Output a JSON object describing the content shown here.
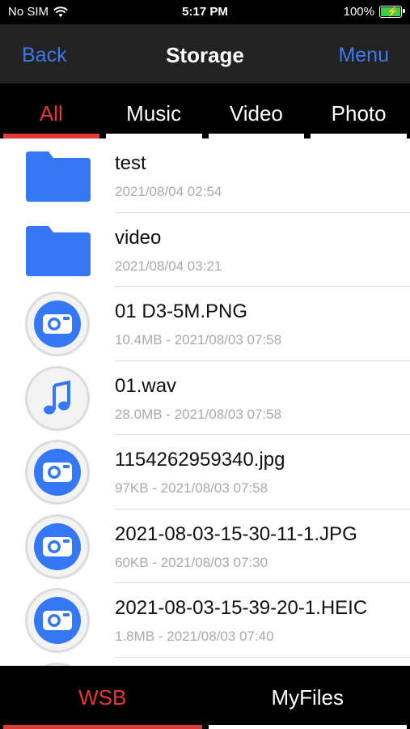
{
  "status_bar": {
    "carrier": "No SIM",
    "time": "5:17 PM",
    "battery": "100%"
  },
  "nav": {
    "back": "Back",
    "title": "Storage",
    "menu": "Menu"
  },
  "tabs": [
    {
      "label": "All",
      "active": true
    },
    {
      "label": "Music",
      "active": false
    },
    {
      "label": "Video",
      "active": false
    },
    {
      "label": "Photo",
      "active": false
    }
  ],
  "files": [
    {
      "type": "folder",
      "name": "test",
      "meta": "2021/08/04 02:54"
    },
    {
      "type": "folder",
      "name": "video",
      "meta": "2021/08/04 03:21"
    },
    {
      "type": "photo",
      "name": "01 D3-5M.PNG",
      "meta": "10.4MB - 2021/08/03 07:58"
    },
    {
      "type": "music",
      "name": "01.wav",
      "meta": "28.0MB - 2021/08/03 07:58"
    },
    {
      "type": "photo",
      "name": "1154262959340.jpg",
      "meta": "97KB - 2021/08/03 07:58"
    },
    {
      "type": "photo",
      "name": "2021-08-03-15-30-11-1.JPG",
      "meta": "60KB - 2021/08/03 07:30"
    },
    {
      "type": "photo",
      "name": "2021-08-03-15-39-20-1.HEIC",
      "meta": "1.8MB - 2021/08/03 07:40"
    }
  ],
  "bottom_tabs": [
    {
      "label": "WSB",
      "active": true
    },
    {
      "label": "MyFiles",
      "active": false
    }
  ],
  "colors": {
    "accent": "#3b7be9",
    "active_tab": "#e03a33",
    "icon_blue": "#3478f6"
  }
}
